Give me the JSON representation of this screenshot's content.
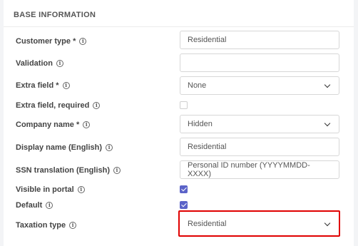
{
  "section": {
    "title": "BASE INFORMATION"
  },
  "info_glyph": "i",
  "fields": {
    "customer_type": {
      "label": "Customer type *",
      "value": "Residential"
    },
    "validation": {
      "label": "Validation",
      "value": ""
    },
    "extra_field": {
      "label": "Extra field *",
      "value": "None"
    },
    "extra_field_required": {
      "label": "Extra field, required",
      "checked": false
    },
    "company_name": {
      "label": "Company name *",
      "value": "Hidden"
    },
    "display_name": {
      "label": "Display name (English)",
      "value": "Residential"
    },
    "ssn_translation": {
      "label": "SSN translation (English)",
      "value": "Personal ID number (YYYYMMDD-XXXX)"
    },
    "visible_in_portal": {
      "label": "Visible in portal",
      "checked": true
    },
    "default": {
      "label": "Default",
      "checked": true
    },
    "taxation_type": {
      "label": "Taxation type",
      "value": "Residential"
    }
  },
  "colors": {
    "accent": "#5b63c8",
    "highlight": "#e00000"
  }
}
